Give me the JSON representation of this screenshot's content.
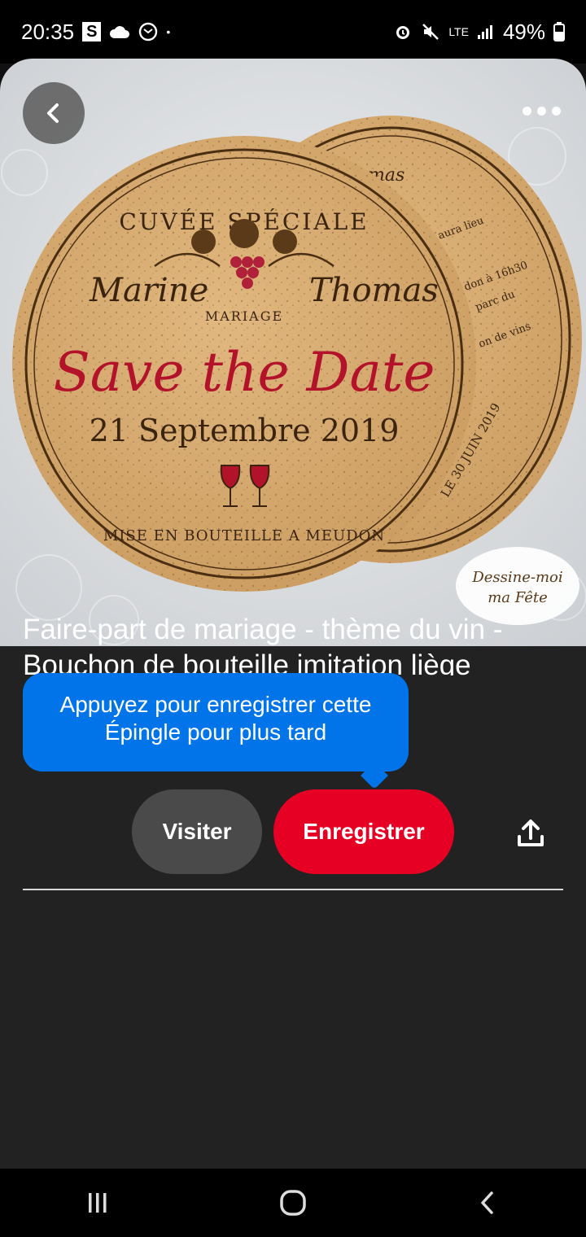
{
  "status_bar": {
    "time": "20:35",
    "s_badge": "S",
    "dot": "•",
    "network": "LTE",
    "battery": "49%"
  },
  "pin_image": {
    "top_text": "CUVÉE SPÉCIALE",
    "name_left": "Marine",
    "name_right": "Thomas",
    "mariage": "MARIAGE",
    "headline": "Save the Date",
    "date": "21 Septembre 2019",
    "bottom_text": "MISE EN BOUTEILLE A MEUDON",
    "back_coaster_top": "mas",
    "back_line_1": "aura lieu",
    "back_line_2": "don à 16h30",
    "back_line_3": "parc du",
    "back_line_4": "on de vins",
    "back_bottom": "LE 30 JUIN 2019",
    "brand_line1": "Dessine-moi",
    "brand_line2": "ma Fête"
  },
  "pin": {
    "title": "Faire-part de mariage - thème du vin - Bouchon de bouteille imitation liège"
  },
  "tooltip": {
    "text": "Appuyez pour enregistrer cette Épingle pour plus tard"
  },
  "actions": {
    "visit_label": "Visiter",
    "save_label": "Enregistrer"
  },
  "colors": {
    "save_red": "#e60023",
    "tooltip_blue": "#0074e8",
    "background": "#222222"
  }
}
